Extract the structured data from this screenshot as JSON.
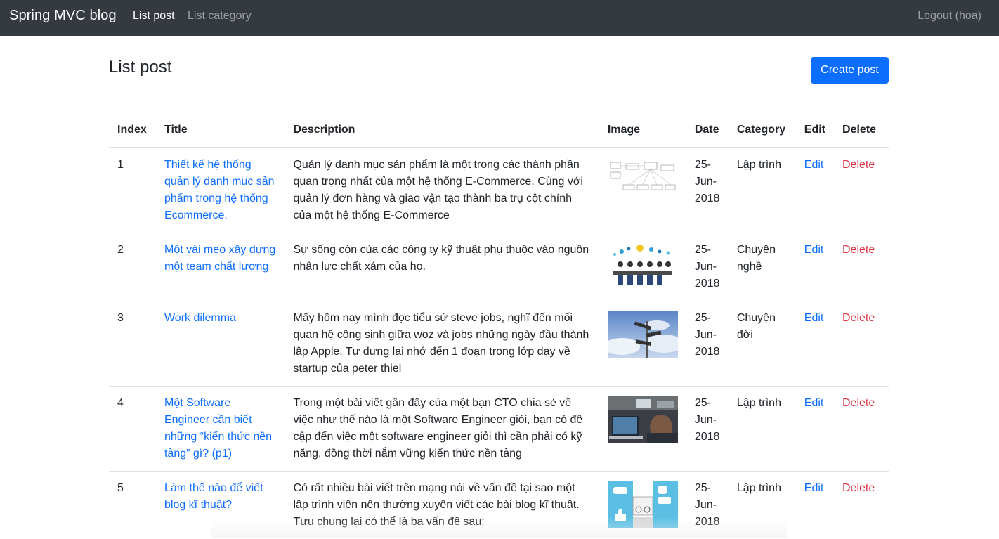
{
  "navbar": {
    "brand": "Spring MVC blog",
    "links": [
      {
        "label": "List post",
        "active": true
      },
      {
        "label": "List category",
        "active": false
      }
    ],
    "logout": "Logout (hoa)"
  },
  "page": {
    "title": "List post",
    "create_button": "Create post"
  },
  "table": {
    "headers": [
      "Index",
      "Title",
      "Description",
      "Image",
      "Date",
      "Category",
      "Edit",
      "Delete"
    ],
    "rows": [
      {
        "index": "1",
        "title": "Thiết kế hệ thống quản lý danh mục sản phẩm trong hệ thống Ecommerce.",
        "description": "Quản lý danh mục sản phẩm là một trong các thành phần quan trọng nhất của một hệ thống E-Commerce. Cùng với quản lý đơn hàng và giao vận tạo thành ba trụ cột chính của một hệ thống E-Commerce",
        "image": "system-diagram-thumbnail",
        "date": "25-Jun-2018",
        "category": "Lập trình",
        "edit": "Edit",
        "delete": "Delete"
      },
      {
        "index": "2",
        "title": "Một vài mẹo xây dựng một team chất lượng",
        "description": "Sự sống còn của các công ty kỹ thuật phụ thuộc vào nguồn nhân lực chất xám của họ.",
        "image": "team-meeting-thumbnail",
        "date": "25-Jun-2018",
        "category": "Chuyện nghề",
        "edit": "Edit",
        "delete": "Delete"
      },
      {
        "index": "3",
        "title": "Work dilemma",
        "description": "Mấy hôm nay mình đọc tiểu sử steve jobs, nghĩ đến mối quan hệ cộng sinh giữa woz và jobs những ngày đầu thành lập Apple. Tự dưng lại nhớ đến 1 đoạn trong lớp dạy về startup của peter thiel",
        "image": "signpost-sky-thumbnail",
        "date": "25-Jun-2018",
        "category": "Chuyện đời",
        "edit": "Edit",
        "delete": "Delete"
      },
      {
        "index": "4",
        "title": "Một Software Engineer cần biết những “kiến thức nền tảng” gì? (p1)",
        "description": "Trong một bài viết gần đây của một bạn CTO chia sẻ về việc như thế nào là một Software Engineer giỏi, bạn có đề cập đến việc một software engineer giỏi thì cần phải có kỹ năng, đồng thời nắm vững kiến thức nền tảng",
        "image": "engineer-laptop-thumbnail",
        "date": "25-Jun-2018",
        "category": "Lập trình",
        "edit": "Edit",
        "delete": "Delete"
      },
      {
        "index": "5",
        "title": "Làm thế nào để viết blog kĩ thuật?",
        "description": "Có rất nhiều bài viết trên mạng nói về vấn đề tại sao một lập trình viên nên thường xuyên viết các bài blog kĩ thuật. Tựu chung lại có thể là ba vấn đề sau:",
        "image": "blogging-illustration-thumbnail",
        "date": "25-Jun-2018",
        "category": "Lập trình",
        "edit": "Edit",
        "delete": "Delete"
      }
    ]
  },
  "colors": {
    "navbar_bg": "#343a40",
    "primary": "#0d6efd",
    "danger": "#dc3545"
  }
}
